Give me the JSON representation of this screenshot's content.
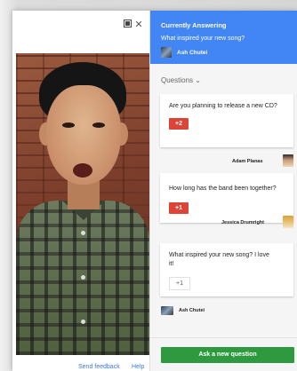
{
  "toolbar": {
    "popout_icon": "popout-icon",
    "close_icon": "close-icon",
    "close_glyph": "✕"
  },
  "footer": {
    "send_feedback": "Send feedback",
    "help": "Help"
  },
  "currently_answering": {
    "title": "Currently Answering",
    "question": "What inspired your new song?",
    "author": "Ash Chutei"
  },
  "questions_header": "Questions ⌄",
  "questions": [
    {
      "text": "Are you planning to release a new CD?",
      "votes": "+2",
      "asker": "Adam Planas"
    },
    {
      "text": "How long has the band been together?",
      "votes": "+1",
      "asker": "Jessica Drumright"
    },
    {
      "text": "What inspired your new song? I love it!",
      "votes": "+1",
      "asker": "Ash Chutei"
    }
  ],
  "ask_button": "Ask a new question",
  "colors": {
    "header_blue": "#4285f4",
    "vote_red": "#db4437",
    "ask_green": "#2e9a3f"
  }
}
